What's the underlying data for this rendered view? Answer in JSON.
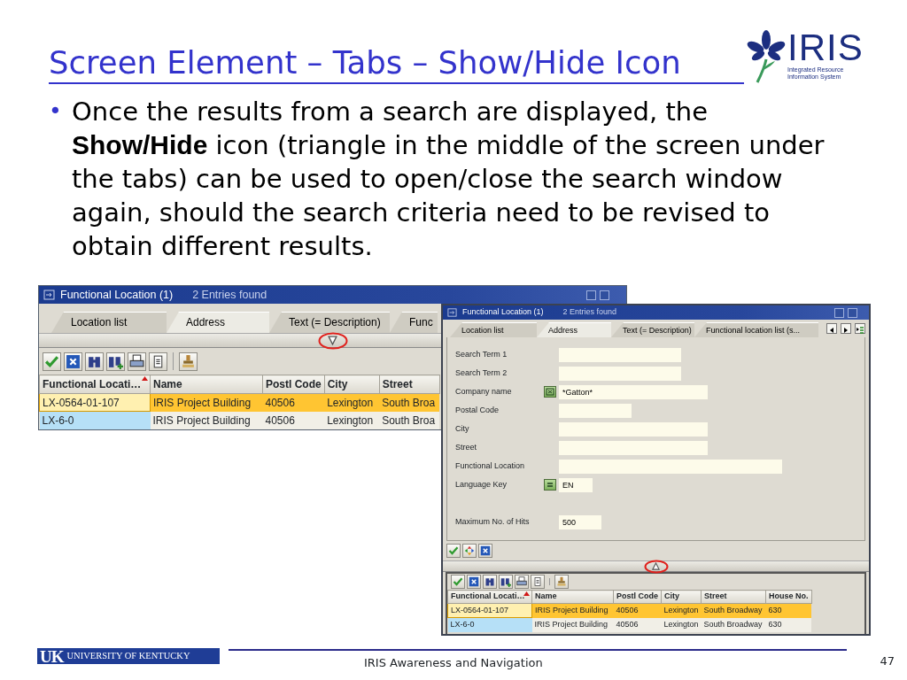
{
  "slide": {
    "title": "Screen Element – Tabs – Show/Hide Icon",
    "marker": "•",
    "bullet": "Once the results from a search are displayed, the **Show/Hide** icon (triangle in the middle of the screen under the tabs) can be used to open/close the search window again, should the search criteria need to be revised to obtain different results."
  },
  "logo": {
    "name": "IRIS",
    "tagline": [
      "Integrated Resource",
      "Information System"
    ]
  },
  "windows": [
    {
      "title": "Functional Location (1)",
      "status": "2 Entries found",
      "tabs": [
        {
          "label": "Location list",
          "selected": false
        },
        {
          "label": "Address",
          "selected": true
        },
        {
          "label": "Text (= Description)",
          "selected": false
        },
        {
          "label": "Func",
          "selected": false
        }
      ],
      "search_expanded": false,
      "columns": [
        "Functional Locati…",
        "Name",
        "Postl Code",
        "City",
        "Street"
      ],
      "rows": [
        {
          "selected": true,
          "cells": [
            "LX-0564-01-107",
            "IRIS Project Building",
            "40506",
            "Lexington",
            "South Broa"
          ]
        },
        {
          "selected": false,
          "cells": [
            "LX-6-0",
            "IRIS Project Building",
            "40506",
            "Lexington",
            "South Broa"
          ]
        }
      ]
    },
    {
      "title": "Functional Location (1)",
      "status": "2 Entries found",
      "tab_scroll_buttons": true,
      "tabs": [
        {
          "label": "Location list",
          "selected": false
        },
        {
          "label": "Address",
          "selected": true
        },
        {
          "label": "Text (= Description)",
          "selected": false
        },
        {
          "label": "Functional location list (s...",
          "selected": false
        }
      ],
      "search_expanded": true,
      "form": [
        {
          "label": "Search Term 1",
          "kind": "plain"
        },
        {
          "label": "Search Term 2",
          "kind": "plain"
        },
        {
          "label": "Company name",
          "kind": "pattern",
          "value": "*Gatton*"
        },
        {
          "label": "Postal Code",
          "kind": "plain"
        },
        {
          "label": "City",
          "kind": "plain"
        },
        {
          "label": "Street",
          "kind": "plain"
        },
        {
          "label": "Functional Location",
          "kind": "plain"
        },
        {
          "label": "Language Key",
          "kind": "equals",
          "value": "EN"
        },
        {
          "label": "Maximum No. of Hits",
          "kind": "plain",
          "value": "500"
        }
      ],
      "columns": [
        "Functional Locati…",
        "Name",
        "Postl Code",
        "City",
        "Street",
        "House No."
      ],
      "rows": [
        {
          "selected": true,
          "cells": [
            "LX-0564-01-107",
            "IRIS Project Building",
            "40506",
            "Lexington",
            "South Broadway",
            "630"
          ]
        },
        {
          "selected": false,
          "cells": [
            "LX-6-0",
            "IRIS Project Building",
            "40506",
            "Lexington",
            "South Broadway",
            "630"
          ]
        }
      ]
    }
  ],
  "footer": {
    "mark": "UK",
    "university": "UNIVERSITY OF KENTUCKY",
    "text": "IRIS Awareness and Navigation",
    "page": "47"
  }
}
